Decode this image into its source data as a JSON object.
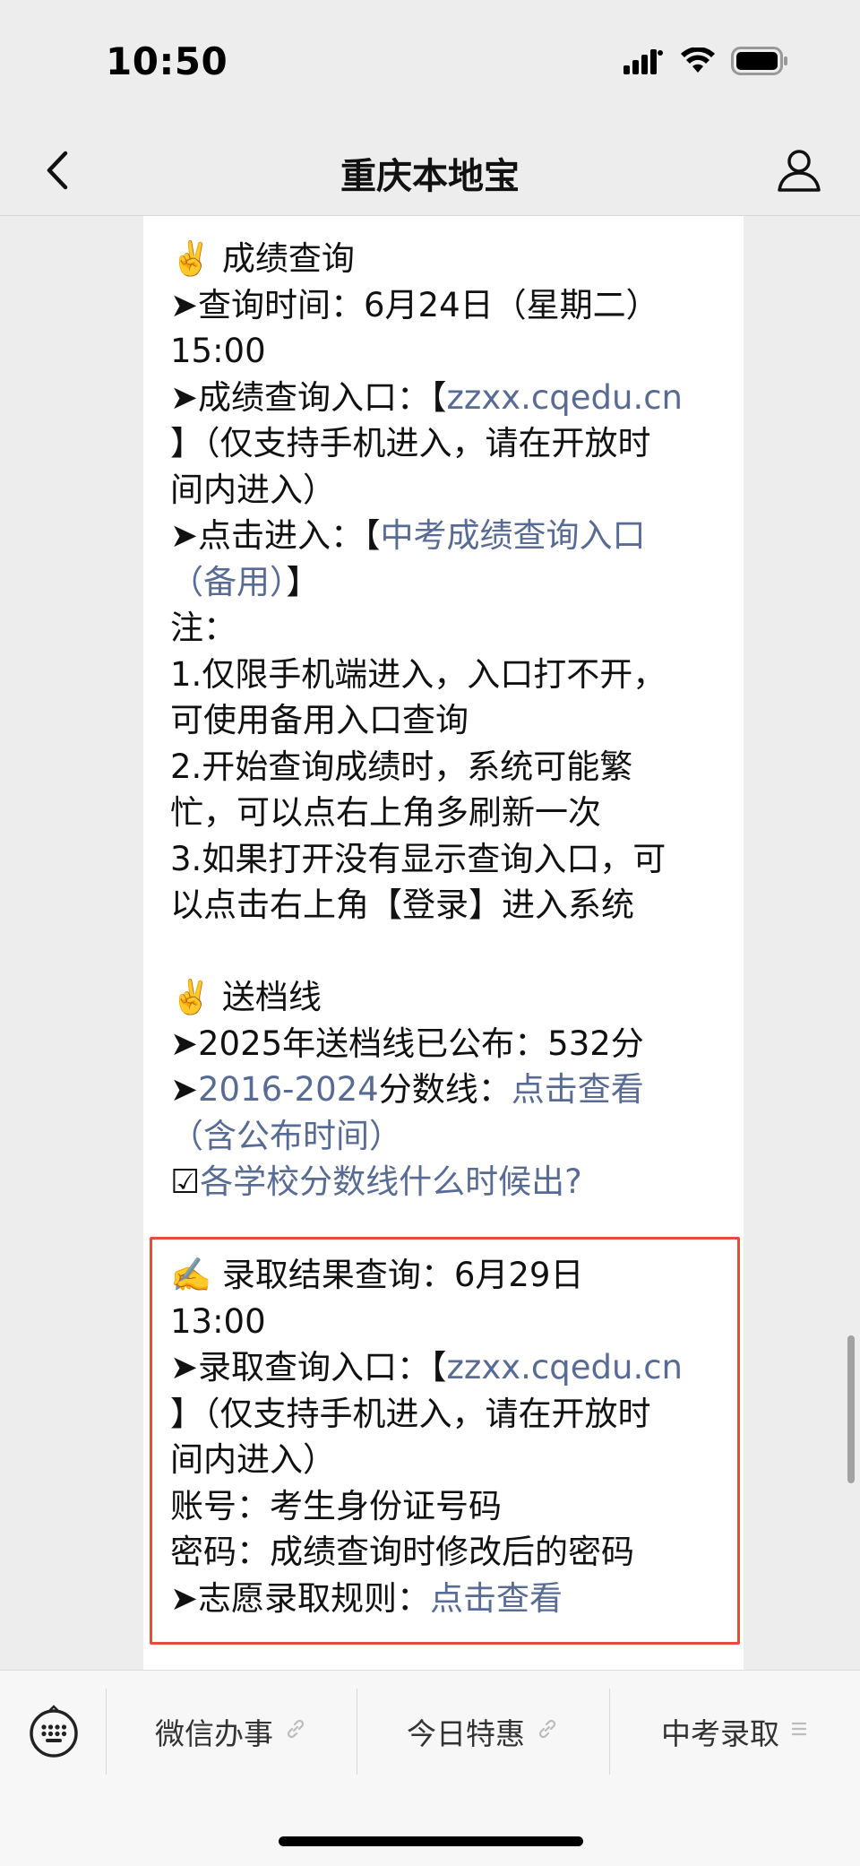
{
  "status_bar": {
    "time": "10:50"
  },
  "nav": {
    "title": "重庆本地宝"
  },
  "article": {
    "sec1_title": "✌️ 成绩查询",
    "sec1_time_a": "➤查询时间：6月24日（星期二）",
    "sec1_time_b": "15:00",
    "sec1_entry_prefix": "➤成绩查询入口：【",
    "sec1_entry_link": "zzxx.cqedu.cn",
    "sec1_entry_suffix_a": "】（仅支持手机进入，请在开放时",
    "sec1_entry_suffix_b": "间内进入）",
    "sec1_click_prefix": "➤点击进入：【",
    "sec1_click_link_a": "中考成绩查询入口",
    "sec1_click_link_b": "（备用）",
    "sec1_click_suffix": "】",
    "note_title": "注：",
    "note1_a": "1.仅限手机端进入，入口打不开，",
    "note1_b": "可使用备用入口查询",
    "note2_a": "2.开始查询成绩时，系统可能繁",
    "note2_b": "忙，可以点右上角多刷新一次",
    "note3_a": "3.如果打开没有显示查询入口，可",
    "note3_b": "以点击右上角【登录】进入系统",
    "sec2_title": "✌️ 送档线",
    "sec2_line1": "➤2025年送档线已公布：532分",
    "sec2_line2_prefix": "➤",
    "sec2_line2_link": "2016-2024",
    "sec2_line2_mid": "分数线：",
    "sec2_line2_link2": "点击查看",
    "sec2_line2_link3": "（含公布时间）",
    "sec2_line3_check": "☑",
    "sec2_line3_link": "各学校分数线什么时候出?"
  },
  "highlight": {
    "title_a": "✍️ 录取结果查询：6月29日",
    "title_b": "13:00",
    "entry_prefix": "➤录取查询入口：【",
    "entry_link": "zzxx.cqedu.cn",
    "entry_suffix_a": "】（仅支持手机进入，请在开放时",
    "entry_suffix_b": "间内进入）",
    "account": "账号：考生身份证号码",
    "password": "密码：成绩查询时修改后的密码",
    "rules_prefix": "➤志愿录取规则：",
    "rules_link": "点击查看"
  },
  "bottom_menu": {
    "items": [
      {
        "label": "微信办事",
        "icon": "link-icon"
      },
      {
        "label": "今日特惠",
        "icon": "link-icon"
      },
      {
        "label": "中考录取",
        "icon": "menu-lines-icon"
      }
    ]
  },
  "colors": {
    "link": "#576b95",
    "highlight_border": "#e84b3c",
    "background": "#ededed"
  }
}
